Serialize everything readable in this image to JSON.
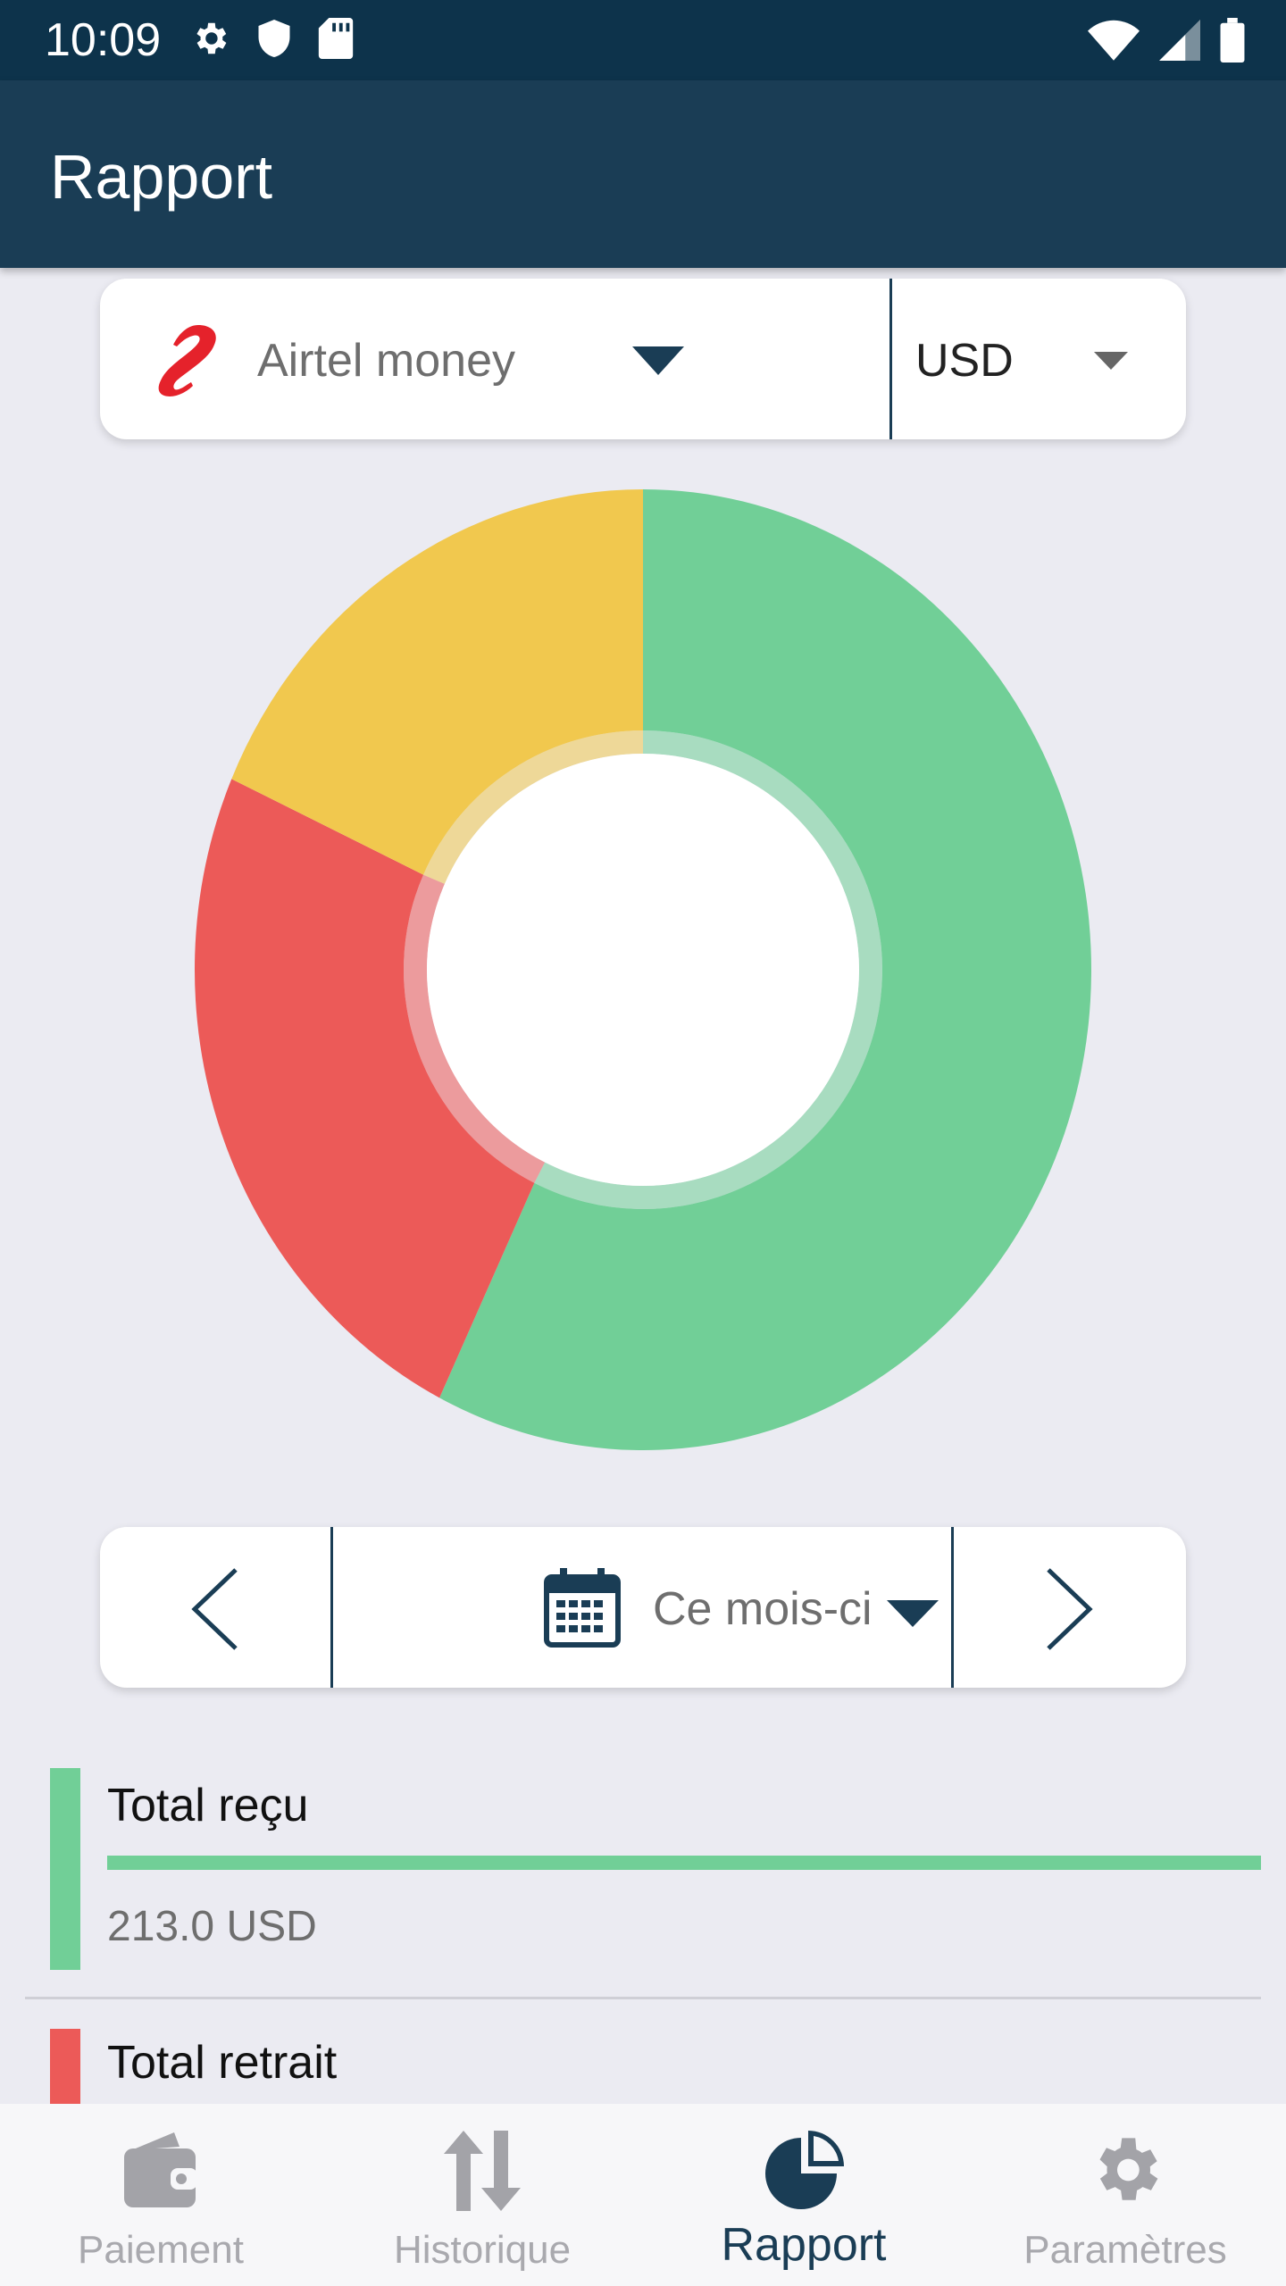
{
  "status_bar": {
    "time": "10:09",
    "left_icons": [
      "settings-icon",
      "shield-icon",
      "sd-card-icon"
    ],
    "right_icons": [
      "wifi-icon",
      "signal-icon",
      "battery-icon"
    ]
  },
  "app_bar": {
    "title": "Rapport",
    "color": "#1a3d55"
  },
  "selector": {
    "operator": "Airtel money",
    "operator_icon": "airtel-logo-icon",
    "currency": "USD"
  },
  "chart_data": {
    "type": "pie",
    "style": "donut",
    "slices": [
      {
        "value": 57.5,
        "color": "#71cf97"
      },
      {
        "value": 24.0,
        "color": "#ec5a58"
      },
      {
        "value": 18.5,
        "color": "#f1c84e"
      }
    ]
  },
  "period": {
    "label": "Ce mois-ci",
    "prev_icon": "chevron-left-icon",
    "next_icon": "chevron-right-icon",
    "calendar_icon": "calendar-icon"
  },
  "summary": [
    {
      "title": "Total reçu",
      "amount": "213.0 USD",
      "color": "#71cf97"
    },
    {
      "title": "Total retrait",
      "amount": "",
      "color": "#ec5a58"
    }
  ],
  "bottom_nav": [
    {
      "label": "Paiement",
      "icon": "wallet-icon",
      "active": false
    },
    {
      "label": "Historique",
      "icon": "swap-vertical-icon",
      "active": false
    },
    {
      "label": "Rapport",
      "icon": "pie-chart-icon",
      "active": true
    },
    {
      "label": "Paramètres",
      "icon": "gear-icon",
      "active": false
    }
  ]
}
